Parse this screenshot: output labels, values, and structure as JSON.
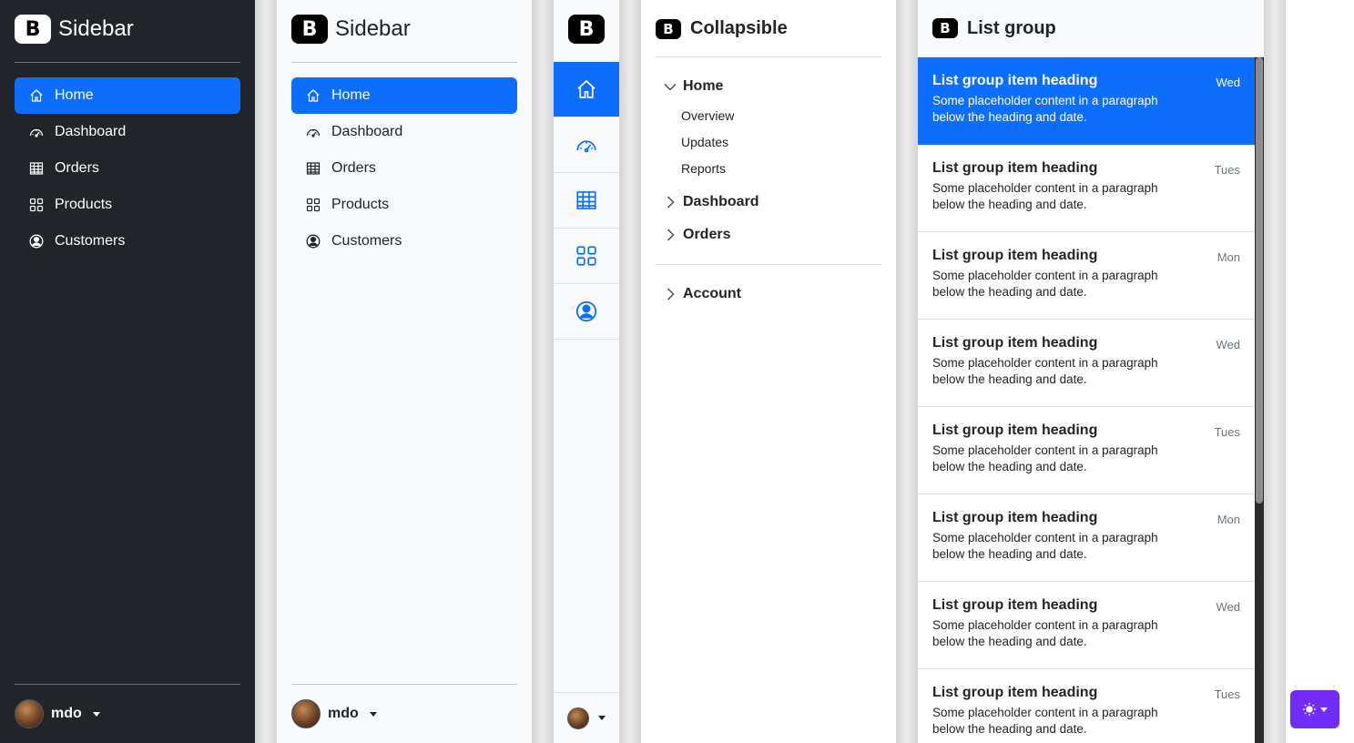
{
  "dark_sidebar": {
    "brand_logo": "B",
    "brand": "Sidebar",
    "items": [
      {
        "label": "Home",
        "icon": "home-icon",
        "active": true
      },
      {
        "label": "Dashboard",
        "icon": "speedometer-icon"
      },
      {
        "label": "Orders",
        "icon": "table-icon"
      },
      {
        "label": "Products",
        "icon": "grid-icon"
      },
      {
        "label": "Customers",
        "icon": "person-circle-icon"
      }
    ],
    "user": "mdo"
  },
  "light_sidebar": {
    "brand_logo": "B",
    "brand": "Sidebar",
    "items": [
      {
        "label": "Home",
        "icon": "home-icon",
        "active": true
      },
      {
        "label": "Dashboard",
        "icon": "speedometer-icon"
      },
      {
        "label": "Orders",
        "icon": "table-icon"
      },
      {
        "label": "Products",
        "icon": "grid-icon"
      },
      {
        "label": "Customers",
        "icon": "person-circle-icon"
      }
    ],
    "user": "mdo"
  },
  "icon_sidebar": {
    "brand_logo": "B",
    "items": [
      "home-icon",
      "speedometer-icon",
      "table-icon",
      "grid-icon",
      "person-circle-icon"
    ]
  },
  "collapsible": {
    "brand_logo": "B",
    "title": "Collapsible",
    "home": "Home",
    "home_items": [
      "Overview",
      "Updates",
      "Reports"
    ],
    "dashboard": "Dashboard",
    "orders": "Orders",
    "account": "Account"
  },
  "list_group": {
    "brand_logo": "B",
    "title": "List group",
    "items": [
      {
        "heading": "List group item heading",
        "text": "Some placeholder content in a paragraph below the heading and date.",
        "date": "Wed",
        "active": true
      },
      {
        "heading": "List group item heading",
        "text": "Some placeholder content in a paragraph below the heading and date.",
        "date": "Tues"
      },
      {
        "heading": "List group item heading",
        "text": "Some placeholder content in a paragraph below the heading and date.",
        "date": "Mon"
      },
      {
        "heading": "List group item heading",
        "text": "Some placeholder content in a paragraph below the heading and date.",
        "date": "Wed"
      },
      {
        "heading": "List group item heading",
        "text": "Some placeholder content in a paragraph below the heading and date.",
        "date": "Tues"
      },
      {
        "heading": "List group item heading",
        "text": "Some placeholder content in a paragraph below the heading and date.",
        "date": "Mon"
      },
      {
        "heading": "List group item heading",
        "text": "Some placeholder content in a paragraph below the heading and date.",
        "date": "Wed"
      },
      {
        "heading": "List group item heading",
        "text": "Some placeholder content in a paragraph below the heading and date.",
        "date": "Tues"
      }
    ]
  },
  "theme_toggle": {
    "icon": "sun-icon"
  },
  "colors": {
    "primary": "#0d6efd",
    "dark": "#212529",
    "light": "#f8f9fa",
    "theme_button": "#712cf9"
  }
}
